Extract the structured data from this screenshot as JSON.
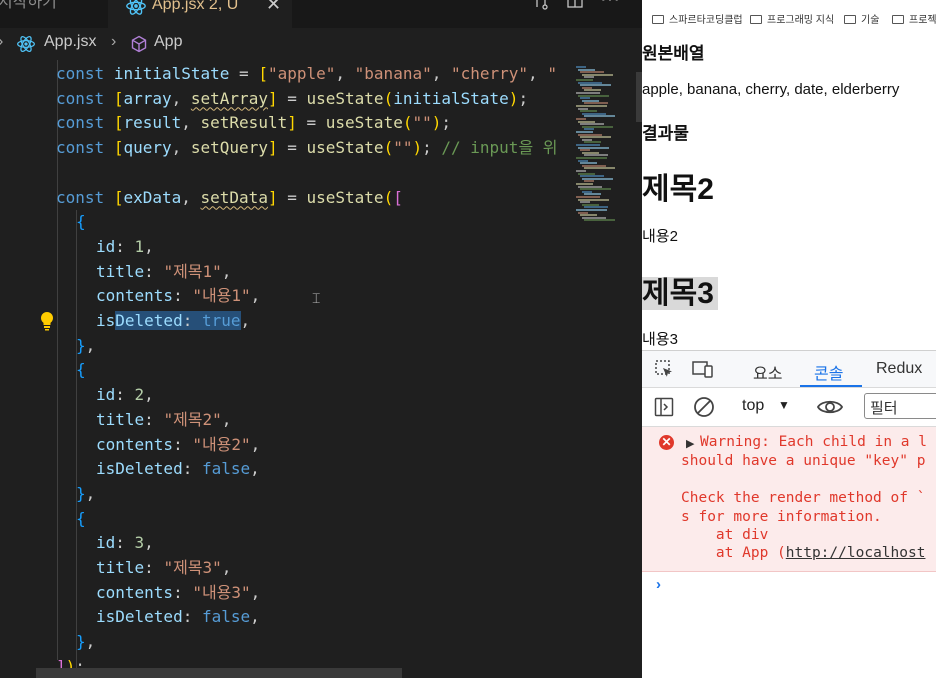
{
  "editor": {
    "inactive_tab": "시작하기",
    "active_tab": {
      "file": "App.jsx",
      "status": "2, U",
      "close": "✕"
    },
    "breadcrumb": {
      "file": "App.jsx",
      "symbol": "App"
    },
    "code": {
      "l1": {
        "kw": "const",
        "name": "initialState",
        "eq": " = ",
        "open": "[",
        "s1": "\"apple\"",
        "s2": "\"banana\"",
        "s3": "\"cherry\"",
        "s4": "\""
      },
      "l2": {
        "kw": "const",
        "a": "array",
        "b": "setArray",
        "fn": "useState",
        "arg": "initialState"
      },
      "l3": {
        "kw": "const",
        "a": "result",
        "b": "setResult",
        "fn": "useState",
        "arg": "\"\""
      },
      "l4": {
        "kw": "const",
        "a": "query",
        "b": "setQuery",
        "fn": "useState",
        "arg": "\"\"",
        "comment": "// input을 위"
      },
      "l6": {
        "kw": "const",
        "a": "exData",
        "b": "setData",
        "fn": "useState"
      },
      "items": [
        {
          "id": "1",
          "title": "\"제목1\"",
          "contents": "\"내용1\"",
          "isDeleted": "true"
        },
        {
          "id": "2",
          "title": "\"제목2\"",
          "contents": "\"내용2\"",
          "isDeleted": "false"
        },
        {
          "id": "3",
          "title": "\"제목3\"",
          "contents": "\"내용3\"",
          "isDeleted": "false"
        }
      ],
      "keys": {
        "id": "id",
        "title": "title",
        "contents": "contents",
        "isDeleted_a": "is",
        "isDeleted_b": "Deleted"
      }
    }
  },
  "browser": {
    "bookmarks": [
      "스파르타코딩클럽",
      "프로그래밍 지식",
      "기술",
      "프로젝"
    ],
    "page": {
      "h_original": "원본배열",
      "original_list": "apple, banana, cherry, date, elderberry",
      "h_result": "결과물",
      "title2": "제목2",
      "content2": "내용2",
      "title3": "제목3",
      "content3": "내용3"
    },
    "devtools": {
      "tabs": [
        "요소",
        "콘솔",
        "Redux"
      ],
      "context": "top",
      "filter_placeholder": "필터",
      "error": {
        "l1": "Warning: Each child in a l",
        "l2": "should have a unique \"key\" p",
        "l3": "Check the render method of `",
        "l4": "s for more information.",
        "l5": "    at div",
        "l6_a": "    at App (",
        "l6_link": "http://localhost"
      },
      "prompt": "›"
    }
  },
  "colors": {
    "accent": "#1a73e8",
    "error": "#e0382b",
    "editor_bg": "#1f1f1f"
  }
}
